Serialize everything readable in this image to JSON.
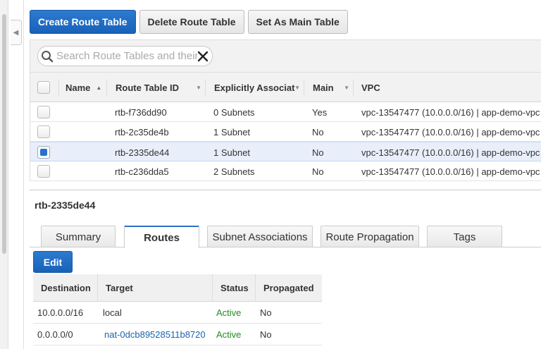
{
  "toolbar": {
    "create_label": "Create Route Table",
    "delete_label": "Delete Route Table",
    "set_main_label": "Set As Main Table"
  },
  "filter": {
    "placeholder": "Search Route Tables and their properties",
    "value": ""
  },
  "table": {
    "headers": {
      "name": "Name",
      "id": "Route Table ID",
      "assoc": "Explicitly Associat",
      "main": "Main",
      "vpc": "VPC"
    },
    "rows": [
      {
        "selected": false,
        "name": "",
        "id": "rtb-f736dd90",
        "assoc": "0 Subnets",
        "main": "Yes",
        "vpc": "vpc-13547477 (10.0.0.0/16) | app-demo-vpc"
      },
      {
        "selected": false,
        "name": "",
        "id": "rtb-2c35de4b",
        "assoc": "1 Subnet",
        "main": "No",
        "vpc": "vpc-13547477 (10.0.0.0/16) | app-demo-vpc"
      },
      {
        "selected": true,
        "name": "",
        "id": "rtb-2335de44",
        "assoc": "1 Subnet",
        "main": "No",
        "vpc": "vpc-13547477 (10.0.0.0/16) | app-demo-vpc"
      },
      {
        "selected": false,
        "name": "",
        "id": "rtb-c236dda5",
        "assoc": "2 Subnets",
        "main": "No",
        "vpc": "vpc-13547477 (10.0.0.0/16) | app-demo-vpc"
      }
    ]
  },
  "detail": {
    "title": "rtb-2335de44",
    "tabs": [
      "Summary",
      "Routes",
      "Subnet Associations",
      "Route Propagation",
      "Tags"
    ],
    "active_tab": "Routes",
    "edit_label": "Edit",
    "routes": {
      "headers": {
        "destination": "Destination",
        "target": "Target",
        "status": "Status",
        "propagated": "Propagated"
      },
      "rows": [
        {
          "destination": "10.0.0.0/16",
          "target": "local",
          "target_is_link": false,
          "status": "Active",
          "propagated": "No"
        },
        {
          "destination": "0.0.0.0/0",
          "target": "nat-0dcb89528511b8720",
          "target_is_link": true,
          "status": "Active",
          "propagated": "No"
        }
      ]
    }
  },
  "colors": {
    "primary": "#1862b8",
    "active_status": "#1e8e1e",
    "link": "#1a63b0",
    "selected_row": "#e8effa"
  }
}
